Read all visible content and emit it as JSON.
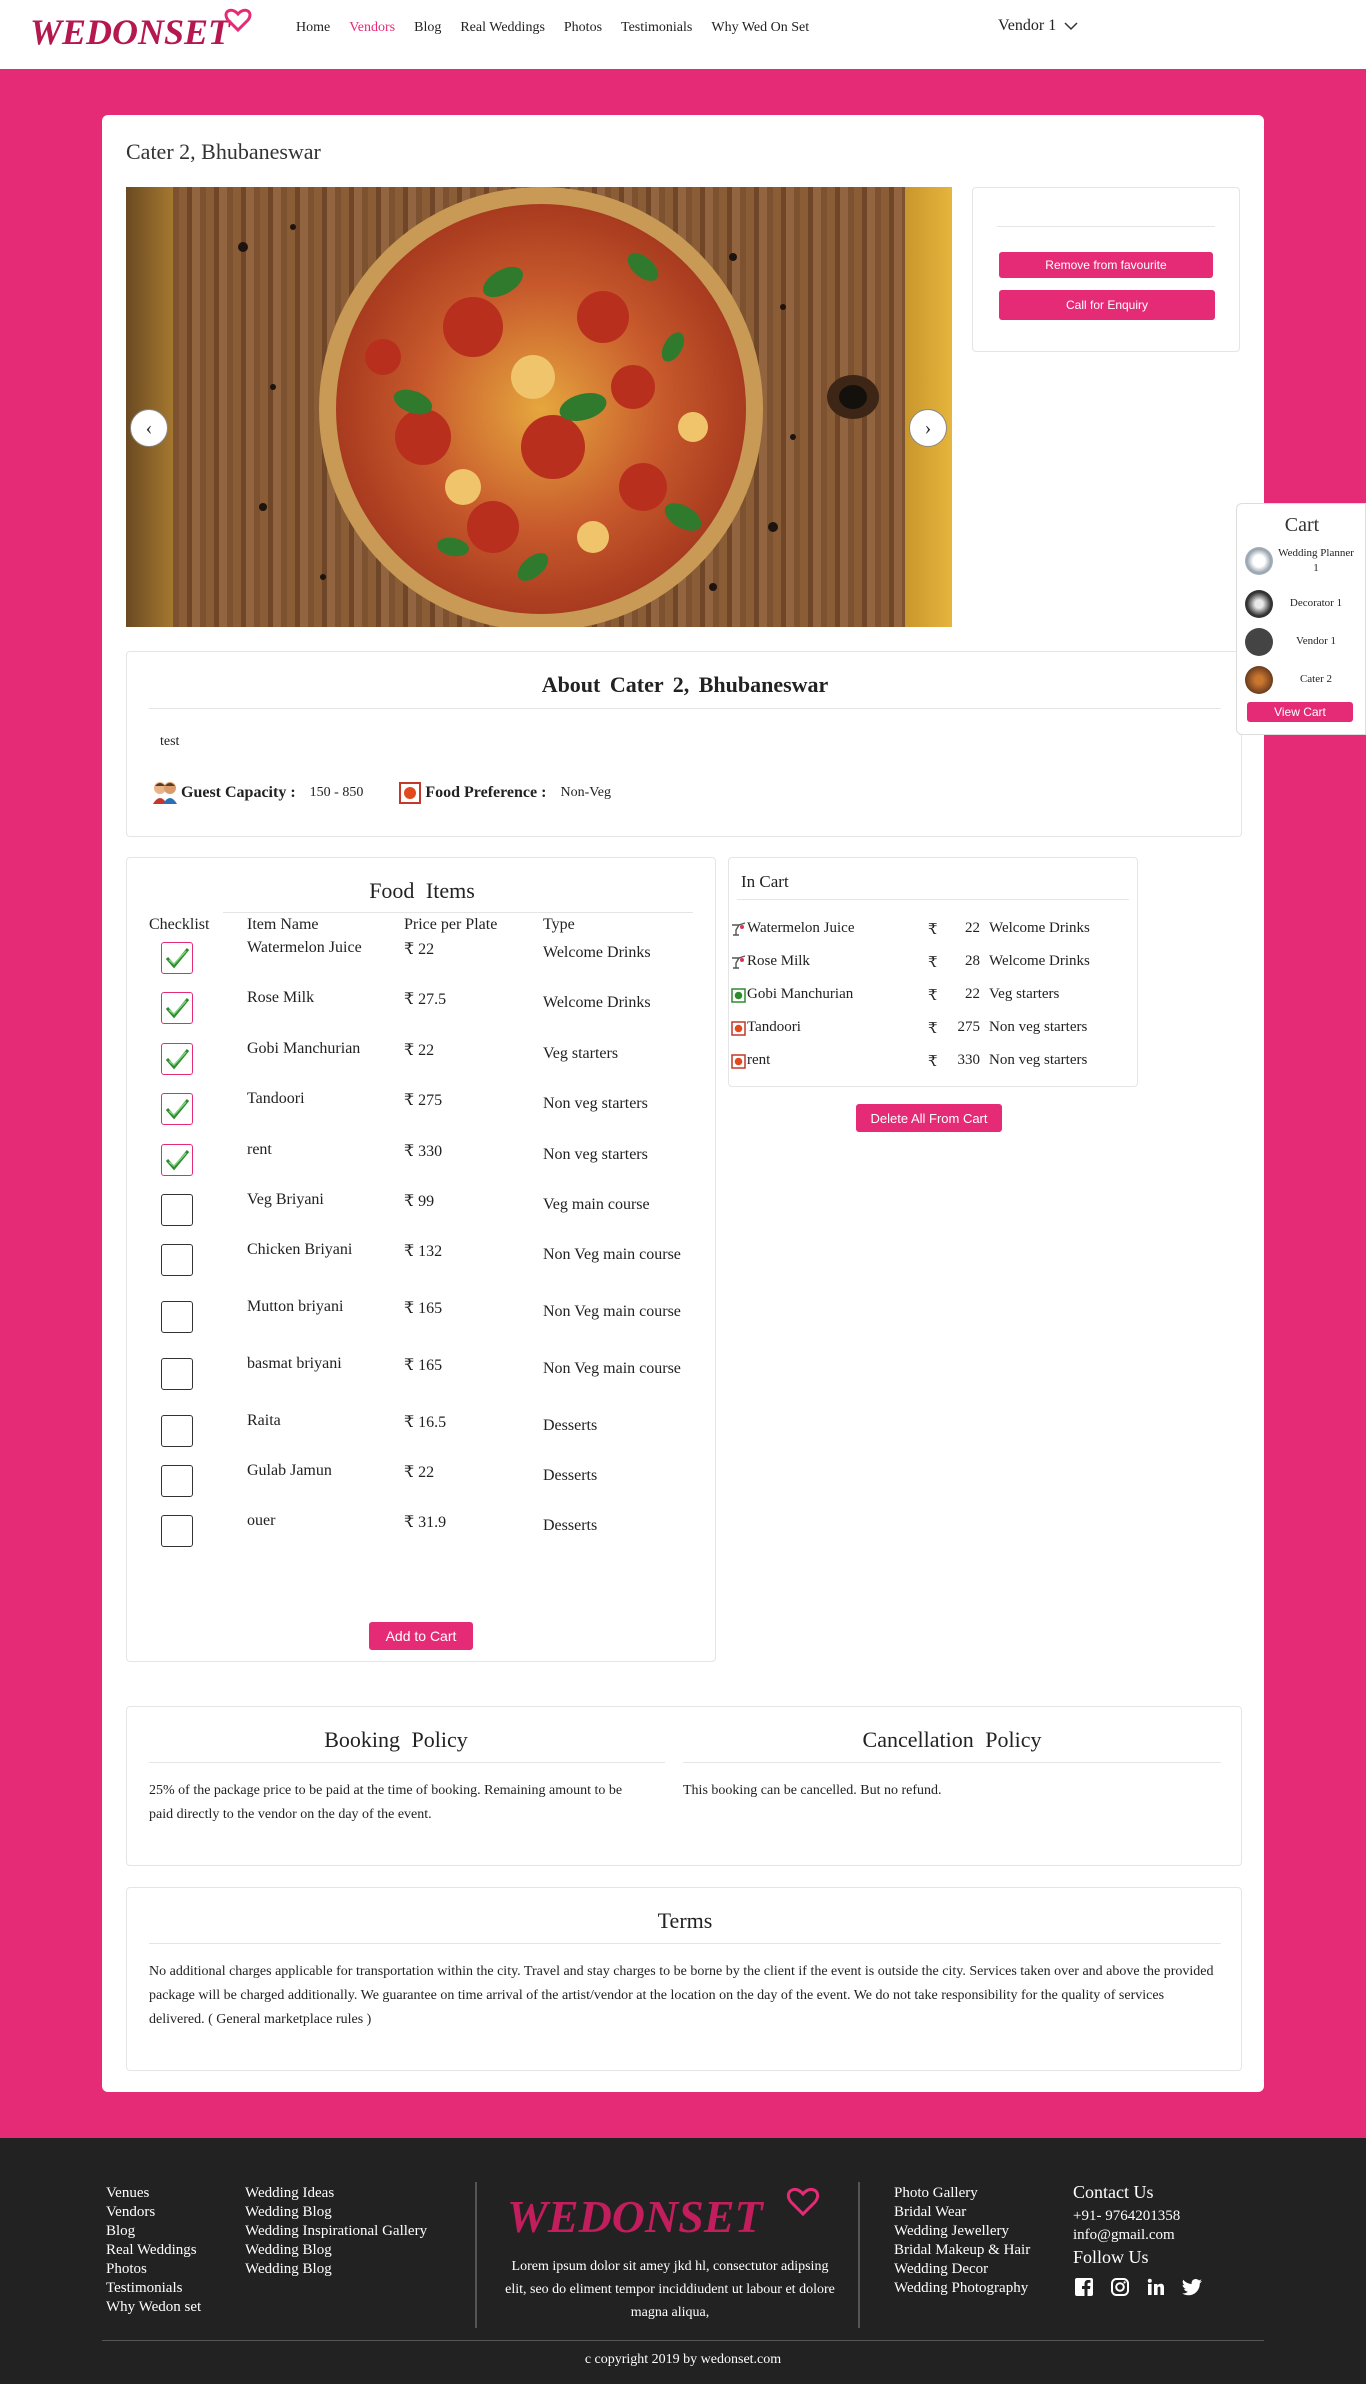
{
  "header": {
    "logo_text": "WEDONSET",
    "nav": [
      "Home",
      "Vendors",
      "Blog",
      "Real Weddings",
      "Photos",
      "Testimonials",
      "Why Wed On Set"
    ],
    "active_nav": "Vendors",
    "user_menu": "Vendor 1"
  },
  "page": {
    "title": "Cater 2, Bhubaneswar",
    "remove_fav": "Remove from favourite",
    "call_enquiry": "Call for Enquiry",
    "prev": "‹",
    "next": "›"
  },
  "cart_widget": {
    "title": "Cart",
    "items": [
      "Wedding Planner 1",
      "Decorator 1",
      "Vendor 1",
      "Cater 2"
    ],
    "button": "View Cart"
  },
  "about": {
    "heading": "About  Cater  2,  Bhubaneswar",
    "description": "test",
    "capacity_label": "Guest Capacity :",
    "capacity_value": "150 - 850",
    "food_pref_label": "Food Preference :",
    "food_pref_value": "Non-Veg"
  },
  "food": {
    "heading": "Food  Items",
    "columns": [
      "Checklist",
      "Item Name",
      "Price per Plate",
      "Type"
    ],
    "rows": [
      {
        "checked": true,
        "name": "Watermelon Juice",
        "price": "₹ 22",
        "type": "Welcome Drinks"
      },
      {
        "checked": true,
        "name": "Rose Milk",
        "price": "₹ 27.5",
        "type": "Welcome Drinks"
      },
      {
        "checked": true,
        "name": "Gobi Manchurian",
        "price": "₹ 22",
        "type": "Veg starters"
      },
      {
        "checked": true,
        "name": "Tandoori",
        "price": "₹ 275",
        "type": "Non veg starters"
      },
      {
        "checked": true,
        "name": "rent",
        "price": "₹ 330",
        "type": "Non veg starters"
      },
      {
        "checked": false,
        "name": "Veg Briyani",
        "price": "₹ 99",
        "type": "Veg main course"
      },
      {
        "checked": false,
        "name": "Chicken Briyani",
        "price": "₹ 132",
        "type": "Non Veg main course"
      },
      {
        "checked": false,
        "name": "Mutton briyani",
        "price": "₹ 165",
        "type": "Non Veg main course"
      },
      {
        "checked": false,
        "name": "basmat briyani",
        "price": "₹ 165",
        "type": "Non Veg main course"
      },
      {
        "checked": false,
        "name": "Raita",
        "price": "₹ 16.5",
        "type": "Desserts"
      },
      {
        "checked": false,
        "name": "Gulab Jamun",
        "price": "₹ 22",
        "type": "Desserts"
      },
      {
        "checked": false,
        "name": "ouer",
        "price": "₹ 31.9",
        "type": "Desserts"
      }
    ],
    "add_button": "Add to Cart"
  },
  "in_cart": {
    "title": "In Cart",
    "rows": [
      {
        "icon": "drink-icon",
        "name": "Watermelon Juice",
        "currency": "₹",
        "price": "22",
        "type": "Welcome Drinks"
      },
      {
        "icon": "drink-icon",
        "name": "Rose Milk",
        "currency": "₹",
        "price": "28",
        "type": "Welcome Drinks"
      },
      {
        "icon": "veg-icon",
        "name": "Gobi Manchurian",
        "currency": "₹",
        "price": "22",
        "type": "Veg starters"
      },
      {
        "icon": "nonveg-icon",
        "name": "Tandoori",
        "currency": "₹",
        "price": "275",
        "type": "Non veg starters"
      },
      {
        "icon": "nonveg-icon",
        "name": "rent",
        "currency": "₹",
        "price": "330",
        "type": "Non veg starters"
      }
    ],
    "delete_all": "Delete All From Cart"
  },
  "policy": {
    "booking_heading": "Booking  Policy",
    "booking_text": "25% of the package price to be paid at the time of booking. Remaining amount to be paid directly to the vendor on the day of the event.",
    "cancel_heading": "Cancellation  Policy",
    "cancel_text": "This booking can be cancelled. But no refund."
  },
  "terms": {
    "heading": "Terms",
    "text": "No additional charges applicable for transportation within the city. Travel and stay charges to be borne by the client if the event is outside the city. Services taken over and above the provided package will be charged additionally. We guarantee on time arrival of the artist/vendor at the location on the day of the event. We do not take responsibility for the quality of services delivered. ( General marketplace rules )"
  },
  "footer": {
    "col1": [
      "Venues",
      "Vendors",
      "Blog",
      "Real Weddings",
      "Photos",
      "Testimonials",
      "Why Wedon set"
    ],
    "col2": [
      "Wedding Ideas",
      "Wedding Blog",
      "Wedding Inspirational Gallery",
      "Wedding Blog",
      "Wedding Blog"
    ],
    "logo_text": "WEDONSET",
    "description": "Lorem ipsum dolor sit amey jkd hl, consectutor adipsing elit, seo do eliment tempor inciddiudent ut labour et dolore magna aliqua,",
    "col3": [
      "Photo Gallery",
      "Bridal Wear",
      "Wedding Jewellery",
      "Bridal Makeup & Hair",
      "Wedding Decor",
      "Wedding Photography"
    ],
    "contact_heading": "Contact Us",
    "phone": "+91- 9764201358",
    "email": "info@gmail.com",
    "follow": "Follow Us",
    "copyright": "c copyright 2019 by wedonset.com"
  },
  "colors": {
    "accent": "#e62b76",
    "footer_bg": "#222222"
  }
}
